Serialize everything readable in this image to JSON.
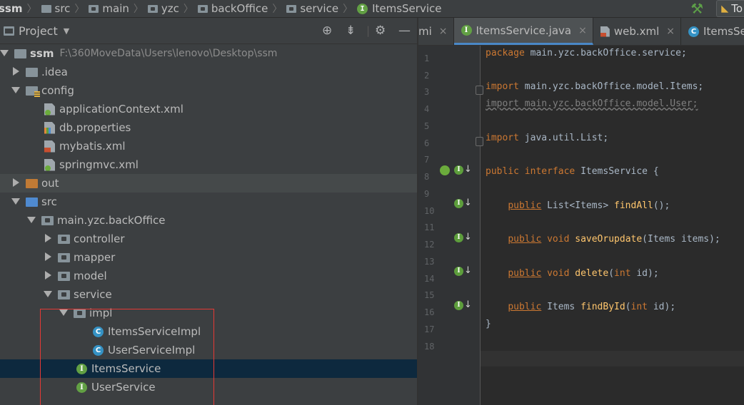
{
  "breadcrumb": [
    "ssm",
    "src",
    "main",
    "yzc",
    "backOffice",
    "service",
    "ItemsService"
  ],
  "toolbar": {
    "run_config_label": "To"
  },
  "project_panel": {
    "title": "Project",
    "tree": [
      {
        "id": "root",
        "name": "ssm",
        "note": "F:\\360MoveData\\Users\\lenovo\\Desktop\\ssm"
      },
      {
        "id": "idea",
        "name": ".idea"
      },
      {
        "id": "config",
        "name": "config"
      },
      {
        "id": "appctx",
        "name": "applicationContext.xml"
      },
      {
        "id": "dbprops",
        "name": "db.properties"
      },
      {
        "id": "mybatis",
        "name": "mybatis.xml"
      },
      {
        "id": "springmvc",
        "name": "springmvc.xml"
      },
      {
        "id": "out",
        "name": "out"
      },
      {
        "id": "src",
        "name": "src"
      },
      {
        "id": "pkg",
        "name": "main.yzc.backOffice"
      },
      {
        "id": "controller",
        "name": "controller"
      },
      {
        "id": "mapper",
        "name": "mapper"
      },
      {
        "id": "model",
        "name": "model"
      },
      {
        "id": "service",
        "name": "service"
      },
      {
        "id": "impl",
        "name": "impl"
      },
      {
        "id": "itemsimpl",
        "name": "ItemsServiceImpl",
        "icon": "C"
      },
      {
        "id": "userimpl",
        "name": "UserServiceImpl",
        "icon": "C"
      },
      {
        "id": "itemsservice",
        "name": "ItemsService",
        "icon": "I"
      },
      {
        "id": "userservice",
        "name": "UserService",
        "icon": "I"
      }
    ]
  },
  "editor": {
    "tabs": [
      {
        "label": "mi",
        "icon": ""
      },
      {
        "label": "ItemsService.java",
        "icon": "I"
      },
      {
        "label": "web.xml",
        "icon": ""
      },
      {
        "label": "ItemsServ",
        "icon": "C"
      }
    ],
    "line_numbers": [
      "1",
      "2",
      "3",
      "4",
      "5",
      "6",
      "7",
      "8",
      "9",
      "10",
      "11",
      "12",
      "13",
      "14",
      "15",
      "16",
      "17",
      "18"
    ],
    "code": {
      "l1_kw": "package",
      "l1_rest": " main.yzc.backOffice.service;",
      "l3_kw": "import",
      "l3_rest": " main.yzc.backOffice.model.Items;",
      "l4": "import main.yzc.backOffice.model.User;",
      "l6_kw": "import",
      "l6_rest": " java.util.List;",
      "l8_kw1": "public",
      "l8_kw2": "interface",
      "l8_rest": " ItemsService {",
      "l10_kw": "public",
      "l10_a": " List<Items> ",
      "l10_fn": "findAll",
      "l10_b": "();",
      "l12_kw": "public",
      "l12_kw2": "void",
      "l12_fn": "saveOrupdate",
      "l12_b": "(Items items);",
      "l14_kw": "public",
      "l14_kw2": "void",
      "l14_fn": "delete",
      "l14_b": "(",
      "l14_kw3": "int",
      "l14_c": " id);",
      "l16_kw": "public",
      "l16_a": " Items ",
      "l16_fn": "findById",
      "l16_b": "(",
      "l16_kw3": "int",
      "l16_c": " id);",
      "l17": "}"
    },
    "gutter_icon_letter": "I",
    "gutter_arrow": "↓"
  },
  "icons": {
    "interface_letter": "I",
    "class_letter": "C",
    "close_glyph": "×",
    "hammer_glyph": "🔨"
  },
  "colors": {
    "keyword": "#cc7832",
    "method": "#ffc66d",
    "selection": "#0d293e",
    "annotation_box": "#e53935"
  }
}
